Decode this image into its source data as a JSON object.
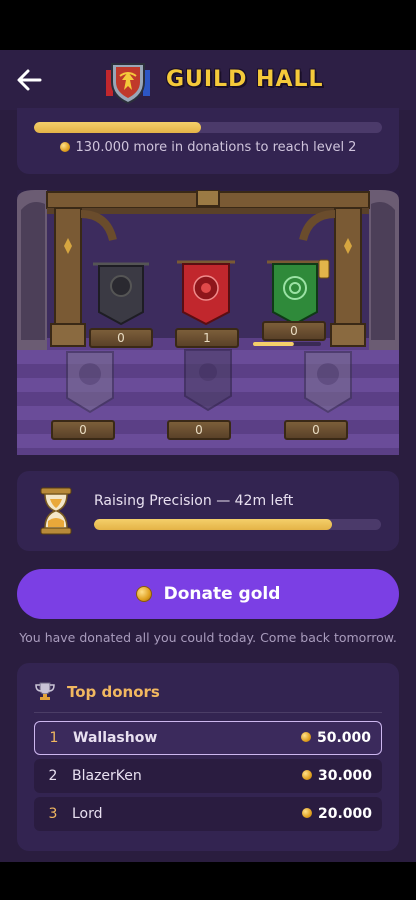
{
  "header": {
    "title": "GUILD HALL",
    "back_icon": "arrow-left-icon",
    "crest_icon": "guild-crest-icon"
  },
  "level_progress": {
    "fraction": 0.48,
    "note": "130.000 more in donations to reach level 2"
  },
  "banners": {
    "top_row": [
      {
        "name": "grey-banner",
        "count": "0",
        "color": "#3b3a44"
      },
      {
        "name": "red-banner",
        "count": "1",
        "color": "#c1272d"
      },
      {
        "name": "green-banner",
        "count": "0",
        "color": "#2f8a3a"
      }
    ],
    "bottom_row": [
      {
        "name": "ghost-banner-left",
        "count": "0"
      },
      {
        "name": "ghost-banner-middle",
        "count": "0"
      },
      {
        "name": "ghost-banner-right",
        "count": "0"
      }
    ],
    "green_banner_progress": 0.6
  },
  "timer": {
    "label": "Raising Precision — 42m left",
    "fraction": 0.83,
    "icon": "hourglass-icon"
  },
  "donate": {
    "label": "Donate gold",
    "note": "You have donated all you could today. Come back tomorrow."
  },
  "donors": {
    "title": "Top donors",
    "icon": "trophy-icon",
    "rows": [
      {
        "rank": "1",
        "name": "Wallashow",
        "amount": "50.000",
        "rank_color": "#f2b860"
      },
      {
        "rank": "2",
        "name": "BlazerKen",
        "amount": "30.000",
        "rank_color": "#e8e0f0"
      },
      {
        "rank": "3",
        "name": "Lord",
        "amount": "20.000",
        "rank_color": "#f2b860"
      }
    ]
  },
  "colors": {
    "accent": "#7b3fe4",
    "gold": "#f4cf6a",
    "background": "#2a1d3f"
  }
}
